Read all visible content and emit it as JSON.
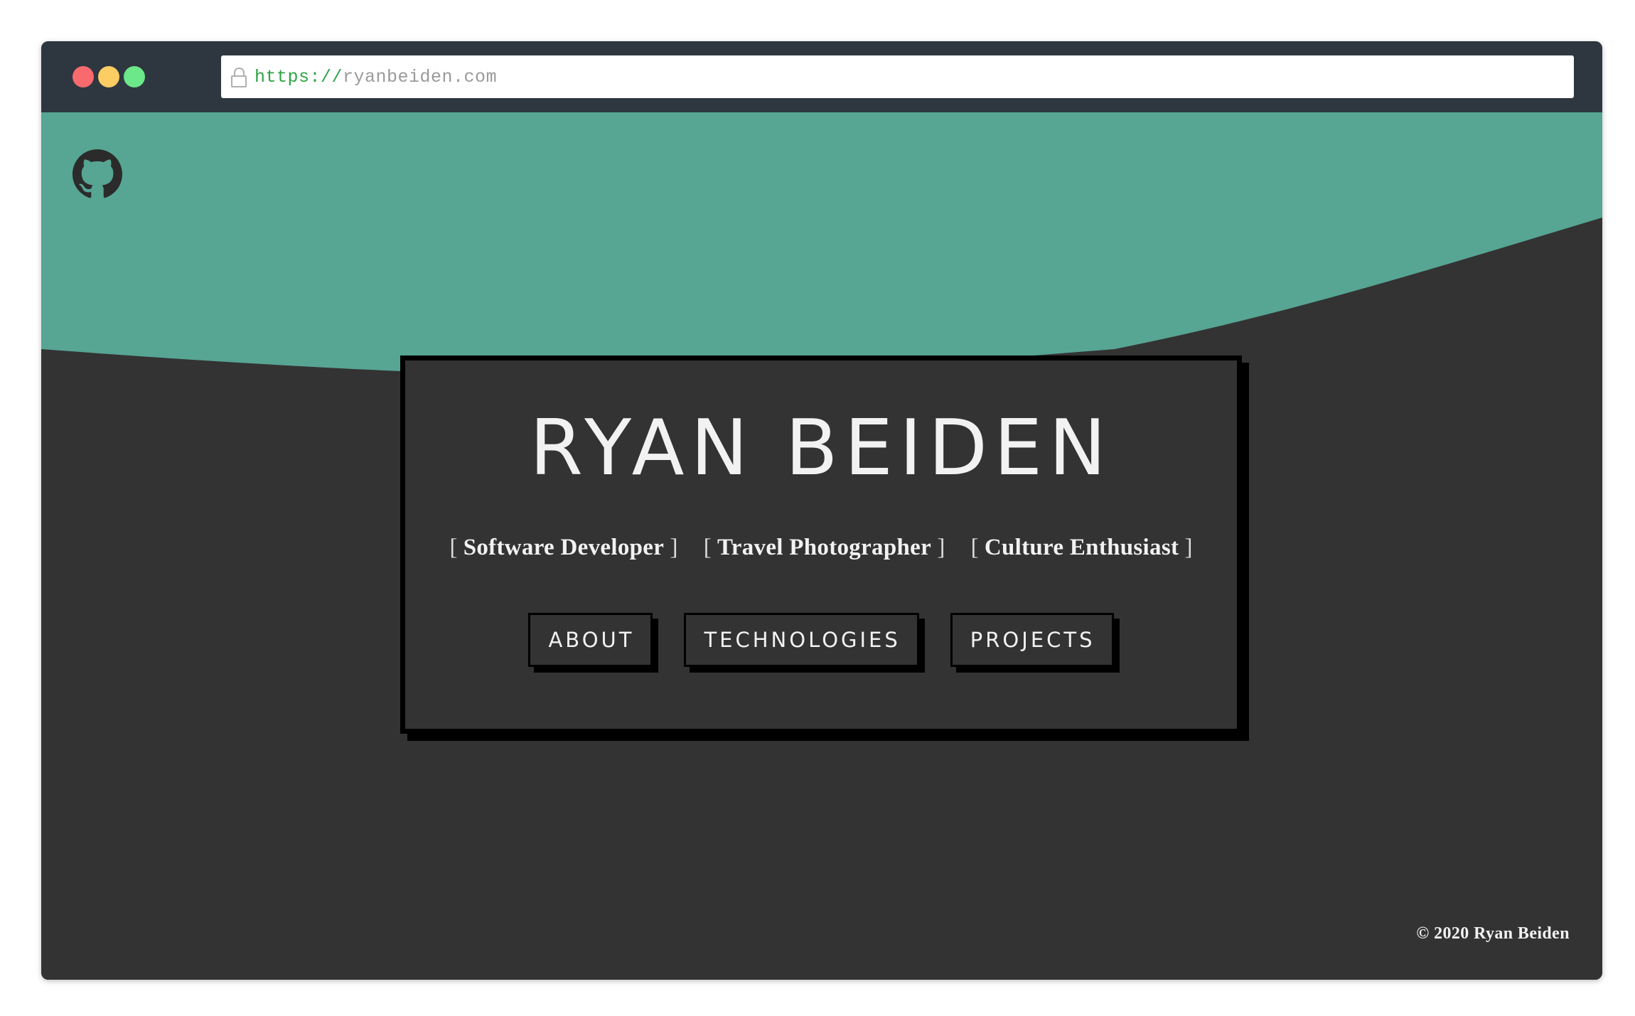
{
  "browser": {
    "url_protocol": "https://",
    "url_host": "ryanbeiden.com",
    "window_buttons": [
      "close",
      "minimize",
      "maximize"
    ]
  },
  "header": {
    "github_icon": "github-icon"
  },
  "hero": {
    "name": "RYAN BEIDEN",
    "roles": [
      {
        "open": "[",
        "text": "Software Developer",
        "close": "]"
      },
      {
        "open": "[",
        "text": "Travel Photographer",
        "close": "]"
      },
      {
        "open": "[",
        "text": "Culture Enthusiast",
        "close": "]"
      }
    ],
    "buttons": {
      "about": "ABOUT",
      "technologies": "TECHNOLOGIES",
      "projects": "PROJECTS"
    }
  },
  "footer": {
    "copyright": "© 2020 Ryan Beiden"
  },
  "colors": {
    "accent": "#57a593",
    "background": "#333333",
    "chrome": "#2e3740",
    "text": "#f2f2f2"
  }
}
